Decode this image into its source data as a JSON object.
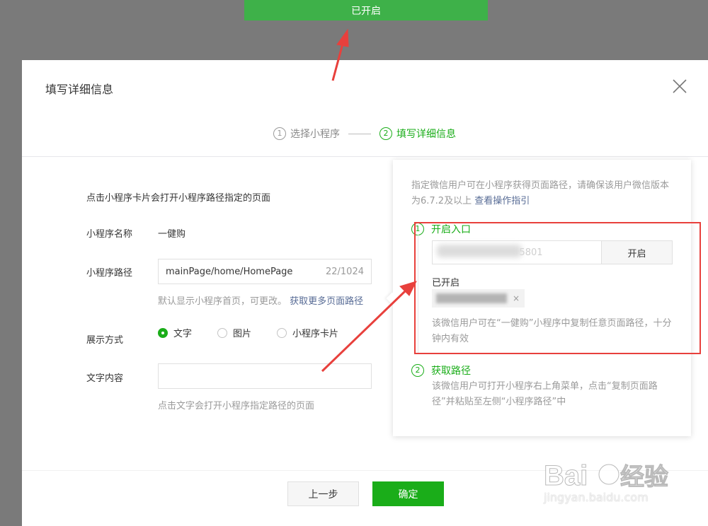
{
  "toast": {
    "text": "已开启"
  },
  "dialog": {
    "title": "填写详细信息",
    "steps": [
      {
        "num": "1",
        "label": "选择小程序"
      },
      {
        "num": "2",
        "label": "填写详细信息"
      }
    ]
  },
  "form": {
    "hint": "点击小程序卡片会打开小程序路径指定的页面",
    "app_name_label": "小程序名称",
    "app_name_value": "一健购",
    "path_label": "小程序路径",
    "path_value": "mainPage/home/HomePage",
    "path_count": "22/1024",
    "path_tip": "默认显示小程序首页，可更改。",
    "path_link": "获取更多页面路径",
    "display_label": "展示方式",
    "display_options": [
      "文字",
      "图片",
      "小程序卡片"
    ],
    "display_selected": "文字",
    "text_label": "文字内容",
    "text_value": "",
    "text_tip": "点击文字会打开小程序指定路径的页面"
  },
  "popover": {
    "desc": "指定微信用户可在小程序获得页面路径，请确保该用户微信版本为6.7.2及以上",
    "desc_link": "查看操作指引",
    "step1_num": "1",
    "step1_title": "开启入口",
    "wechat_input_value": "5801",
    "open_button": "开启",
    "opened_label": "已开启",
    "tag_close": "×",
    "note1": "该微信用户可在“一健购”小程序中复制任意页面路径，十分钟内有效",
    "step2_num": "2",
    "step2_title": "获取路径",
    "note2": "该微信用户可打开小程序右上角菜单，点击“复制页面路径”并粘贴至左侧“小程序路径”中"
  },
  "buttons": {
    "prev": "上一步",
    "ok": "确定"
  },
  "watermark": {
    "brand": "Baidu经验",
    "url": "jingyan.baidu.com"
  },
  "colors": {
    "accent": "#1aad19",
    "toast": "#3eb149",
    "annotation": "#e8403c",
    "link": "#576b95"
  }
}
